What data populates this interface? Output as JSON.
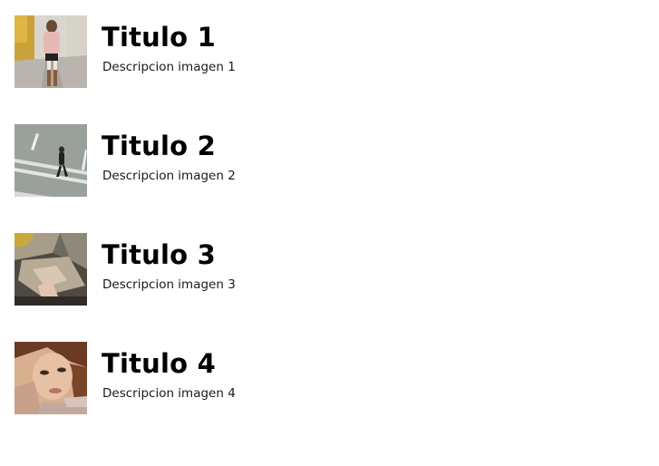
{
  "items": [
    {
      "title": "Titulo 1",
      "description": "Descripcion imagen 1"
    },
    {
      "title": "Titulo 2",
      "description": "Descripcion imagen 2"
    },
    {
      "title": "Titulo 3",
      "description": "Descripcion imagen 3"
    },
    {
      "title": "Titulo 4",
      "description": "Descripcion imagen 4"
    }
  ]
}
